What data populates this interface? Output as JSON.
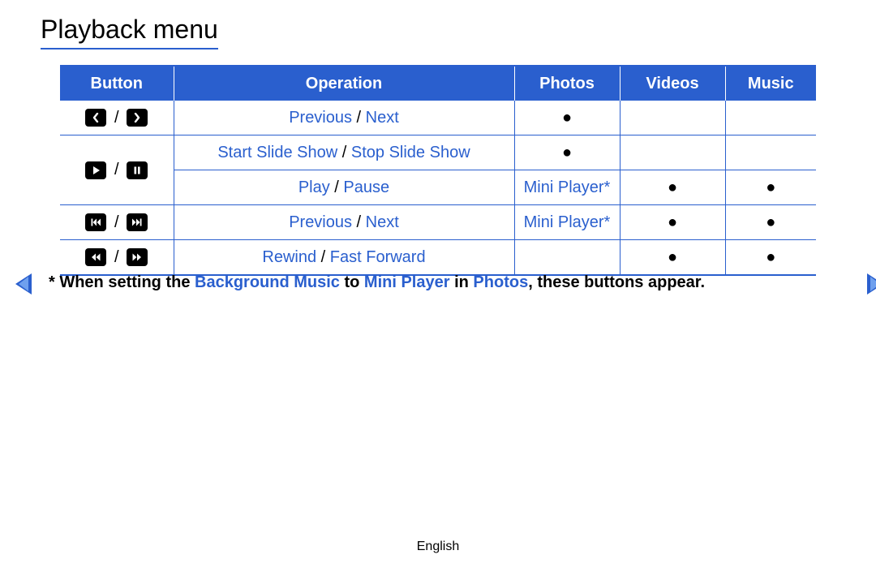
{
  "title": "Playback menu",
  "columns": {
    "button": "Button",
    "operation": "Operation",
    "photos": "Photos",
    "videos": "Videos",
    "music": "Music"
  },
  "rows": {
    "r0": {
      "op_a": "Previous",
      "op_sep": " / ",
      "op_b": "Next",
      "photos": "●",
      "videos": "",
      "music": ""
    },
    "r1": {
      "op_a": "Start Slide Show",
      "op_sep": " / ",
      "op_b": "Stop Slide Show",
      "photos": "●",
      "videos": "",
      "music": ""
    },
    "r2": {
      "op_a": "Play",
      "op_sep": " / ",
      "op_b": "Pause",
      "photos": "Mini Player*",
      "videos": "●",
      "music": "●"
    },
    "r3": {
      "op_a": "Previous",
      "op_sep": " / ",
      "op_b": "Next",
      "photos": "Mini Player*",
      "videos": "●",
      "music": "●"
    },
    "r4": {
      "op_a": "Rewind",
      "op_sep": " / ",
      "op_b": "Fast Forward",
      "photos": "",
      "videos": "●",
      "music": "●"
    }
  },
  "footnote": {
    "lead": "* When setting the ",
    "a": "Background Music",
    "mid1": " to ",
    "b": "Mini Player",
    "mid2": " in ",
    "c": "Photos",
    "end": ", these buttons appear."
  },
  "footer": "English",
  "sep": " / "
}
